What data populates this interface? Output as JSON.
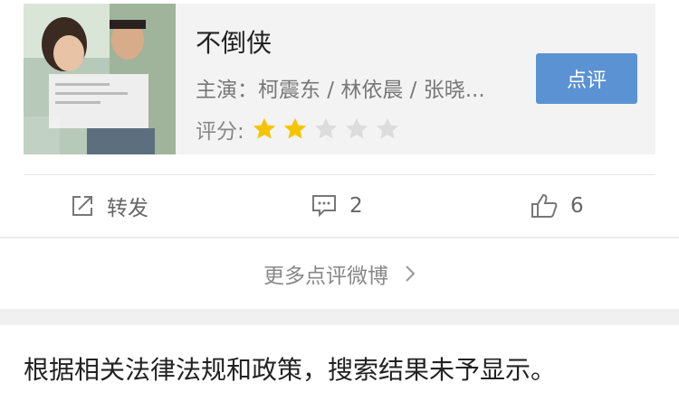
{
  "movie": {
    "title": "不倒侠",
    "cast": "主演：柯震东 / 林依晨 / 张晓...",
    "rating_label": "评分:",
    "rating_stars": 2,
    "rating_max": 5,
    "review_button": "点评"
  },
  "actions": {
    "forward_label": "转发",
    "comment_count": "2",
    "like_count": "6"
  },
  "more_link": "更多点评微博",
  "notice": "根据相关法律法规和政策，搜索结果未予显示。",
  "colors": {
    "accent": "#5b92d3",
    "star_on": "#f5c400",
    "star_off": "#dcdcdc"
  }
}
